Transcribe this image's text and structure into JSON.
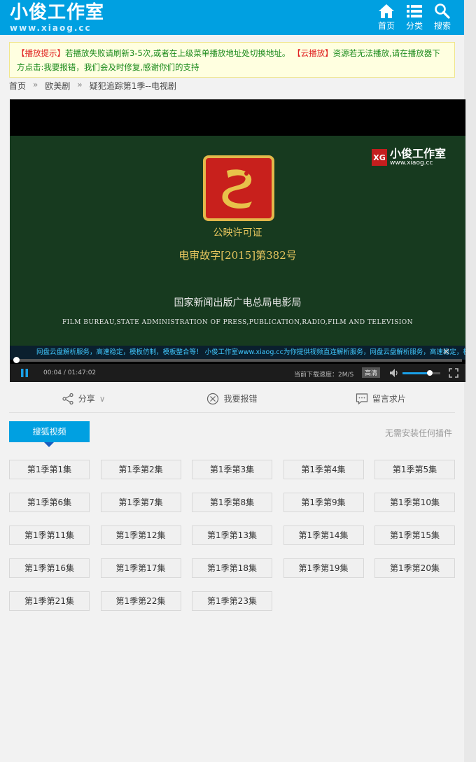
{
  "header": {
    "logo_title": "小俊工作室",
    "logo_url": "www.xiaog.cc",
    "nav": [
      {
        "label": "首页",
        "icon": "home-icon"
      },
      {
        "label": "分类",
        "icon": "list-icon"
      },
      {
        "label": "搜索",
        "icon": "search-icon"
      }
    ]
  },
  "notice": {
    "tag1": "【播放提示】",
    "text1": "若播放失败请刷新3-5次,或者在上级菜单播放地址处切换地址。",
    "tag2": "【云播放】",
    "text2": "资源若无法播放,请在播放器下方点击:我要报错，我们会及时修复,感谢你们的支持"
  },
  "breadcrumb": {
    "home": "首页",
    "sep": "»",
    "category": "欧美剧",
    "current": "疑犯追踪第1季--电视剧"
  },
  "player": {
    "brand_name": "小俊工作室",
    "brand_url": "www.xiaog.cc",
    "brand_mark": "XG",
    "film_line1": "公映许可证",
    "film_line2": "电审故字[2015]第382号",
    "film_line3": "国家新闻出版广电总局电影局",
    "film_line4": "FILM BUREAU,STATE ADMINISTRATION OF PRESS,PUBLICATION,RADIO,FILM AND TELEVISION",
    "marquee": "网盘云盘解析服务，高速稳定，模板仿制，模板整合等！  小俊工作室www.xiaog.cc为你提供视频直连解析服务，网盘云盘解析服务，高速稳定，模板仿",
    "marquee_close": "✕",
    "time_current": "00:04",
    "time_sep": "/",
    "time_total": "01:47:02",
    "speed": "当前下载速度：2M/S",
    "quality": "高清",
    "progress_fraction": 0.005,
    "volume_fraction": 0.72
  },
  "actions": [
    {
      "label": "分享",
      "icon": "share-icon",
      "suffix": "∨"
    },
    {
      "label": "我要报错",
      "icon": "report-icon",
      "suffix": ""
    },
    {
      "label": "留言求片",
      "icon": "message-icon",
      "suffix": ""
    }
  ],
  "source": {
    "tab": "搜狐视频",
    "note": "无需安装任何插件"
  },
  "episodes": [
    "第1季第1集",
    "第1季第2集",
    "第1季第3集",
    "第1季第4集",
    "第1季第5集",
    "第1季第6集",
    "第1季第7集",
    "第1季第8集",
    "第1季第9集",
    "第1季第10集",
    "第1季第11集",
    "第1季第12集",
    "第1季第13集",
    "第1季第14集",
    "第1季第15集",
    "第1季第16集",
    "第1季第17集",
    "第1季第18集",
    "第1季第19集",
    "第1季第20集",
    "第1季第21集",
    "第1季第22集",
    "第1季第23集"
  ],
  "colors": {
    "accent": "#00a0e1",
    "notice_bg": "#ffffe0",
    "notice_text": "#1a8a1a",
    "notice_tag": "#e02020"
  }
}
